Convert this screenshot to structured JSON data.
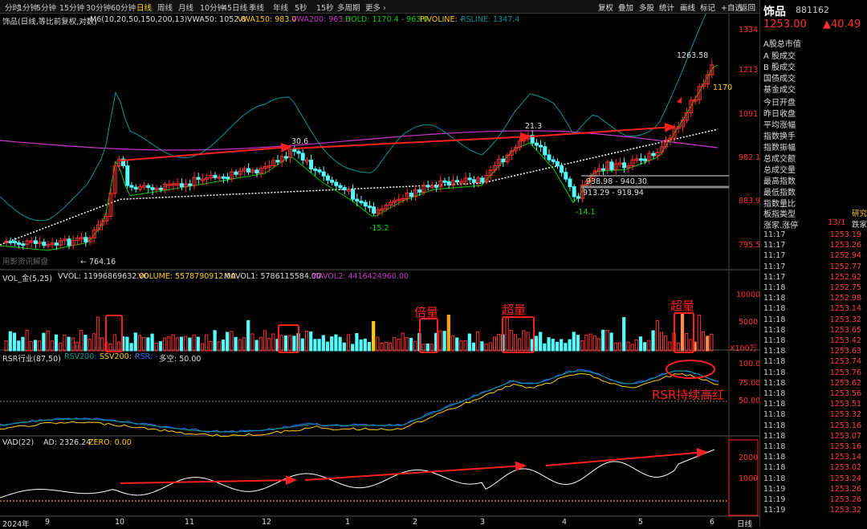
{
  "toolbar": {
    "tabs": [
      "分时",
      "1分钟",
      "5分钟",
      "15分钟",
      "30分钟",
      "60分钟",
      "日线",
      "周线",
      "月线",
      "10分钟",
      "45日线",
      "季线",
      "年线",
      "5秒",
      "15秒",
      "多周期",
      "更多 ›"
    ],
    "active": "日线",
    "tools": [
      "复权",
      "叠加",
      "多股",
      "统计",
      "画线",
      "标记",
      "+自选",
      "返回"
    ]
  },
  "main_legend": {
    "title": "饰品(日线,等比前复权,对数)",
    "ma": "M6(10,20,50,150,200,13)",
    "vwa50": "VWA50: 1052.8",
    "vwa150": "VWA150: 983.0",
    "vwa200": "VWA200: 963.0",
    "hold": "HOLD: 1170.4 - 963.0",
    "pivoline": "PIVOLINE: -",
    "rsline": "RSLINE: 1347.4"
  },
  "price_axis": [
    "1334",
    "1213",
    "1091",
    "982.1",
    "883.9",
    "795.5"
  ],
  "annotations": {
    "high": "1263.58",
    "p1": "30.6",
    "p2": "21.3",
    "n1": "-15.2",
    "n2": "-14.1",
    "low": "764.16",
    "r1": "938.98 - 940.30",
    "r2": "913.29 - 918.94",
    "cur": "1170",
    "watermark": "用影资讯解盘"
  },
  "vol_legend": {
    "name": "VOL_金(5,25)",
    "vvol": "VVOL: 11996869632.00",
    "volume": "VOLUME: 5578790912.00",
    "mavol1": "MAVOL1: 5786115584.00",
    "mavol2": "MAVOL2: 4416424960.00"
  },
  "vol_axis": [
    "10000",
    "5000",
    "X100万"
  ],
  "vol_notes": [
    "倍量",
    "超量",
    "超量"
  ],
  "rsr_legend": {
    "name": "RSR行业(87,50)",
    "a": "RSV200: -",
    "b": "SSV200: -",
    "c": "RSR: -",
    "d": "多空: 50.00"
  },
  "rsr_axis": [
    "100.0",
    "75.00",
    "50.00"
  ],
  "rsr_note": "RSR持续高红",
  "vad_legend": {
    "name": "VAD(22)",
    "ad": "AD: 2326.24",
    "zero": "ZERO: 0.00"
  },
  "vad_axis": [
    "2000",
    "1000"
  ],
  "time_axis": {
    "year": "2024年",
    "months": [
      "9",
      "10",
      "11",
      "12",
      "1",
      "2",
      "3",
      "4",
      "5",
      "6"
    ],
    "freq": "日线"
  },
  "right": {
    "name": "饰品",
    "code": "881162",
    "price": "1253.00",
    "change": "▲40.49",
    "items": [
      "A股总市值",
      "A 股成交",
      "B 股成交",
      "国债成交",
      "基金成交",
      "今日开盘",
      "昨日收盘",
      "平均涨幅",
      "指数换手",
      "指数振幅",
      "总成交额",
      "总成交量",
      "最高指数",
      "最低指数",
      "指数量比",
      "板指类型",
      "涨家.涨停"
    ],
    "board_type": "研究",
    "up_count": "13/1",
    "down_label": "跌家",
    "ticks": [
      [
        "11:17",
        "1253.19"
      ],
      [
        "11:17",
        "1253.26"
      ],
      [
        "11:17",
        "1252.94"
      ],
      [
        "11:17",
        "1252.77"
      ],
      [
        "11:17",
        "1252.92"
      ],
      [
        "11:18",
        "1252.75"
      ],
      [
        "11:18",
        "1252.98"
      ],
      [
        "11:18",
        "1253.14"
      ],
      [
        "11:18",
        "1253.32"
      ],
      [
        "11:18",
        "1253.65"
      ],
      [
        "11:18",
        "1253.42"
      ],
      [
        "11:18",
        "1253.63"
      ],
      [
        "11:18",
        "1253.74"
      ],
      [
        "11:18",
        "1253.76"
      ],
      [
        "11:18",
        "1253.62"
      ],
      [
        "11:18",
        "1253.56"
      ],
      [
        "11:18",
        "1253.51"
      ],
      [
        "11:18",
        "1253.32"
      ],
      [
        "11:18",
        "1253.16"
      ],
      [
        "11:18",
        "1253.07"
      ],
      [
        "11:18",
        "1253.16"
      ],
      [
        "11:18",
        "1253.14"
      ],
      [
        "11:18",
        "1253.02"
      ],
      [
        "11:18",
        "1253.24"
      ],
      [
        "11:19",
        "1253.26"
      ],
      [
        "11:19",
        "1253.26"
      ],
      [
        "11:19",
        "1253.32"
      ]
    ]
  },
  "colors": {
    "up": "#ff3030",
    "down": "#54ffff",
    "ma_white": "#ffffff",
    "ma_yellow": "#ffcc00",
    "ma_green": "#00cc00",
    "ma_purple": "#cc33cc",
    "rsline": "#009999",
    "arrow": "#ff2020"
  }
}
